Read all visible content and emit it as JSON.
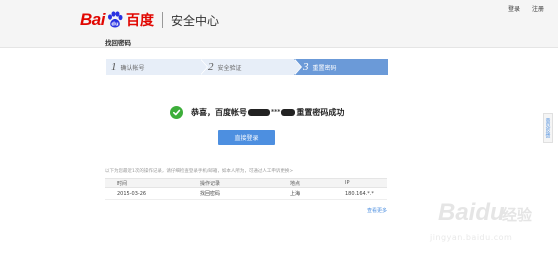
{
  "header": {
    "logo_bai": "Bai",
    "logo_du": "百度",
    "title": "安全中心",
    "links": [
      "登录",
      "注册"
    ]
  },
  "page": {
    "subtitle": "找回密码"
  },
  "steps": [
    {
      "num": "1",
      "label": "确认帐号"
    },
    {
      "num": "2",
      "label": "安全验证"
    },
    {
      "num": "3",
      "label": "重置密码"
    }
  ],
  "result": {
    "prefix": "恭喜，百度帐号",
    "middle": "***",
    "suffix": "重置密码成功"
  },
  "login_button": "直接登录",
  "note": "以下为您最近1次的操作记录，请仔细检查登录手机/邮箱，如本人所为，可通过人工申诉更换>",
  "table": {
    "headers": [
      "时间",
      "操作记录",
      "地点",
      "IP"
    ],
    "rows": [
      {
        "time": "2015-03-26",
        "action": "找回密码",
        "location": "上海",
        "ip": "180.164.*.*"
      }
    ],
    "view_more": "查看更多"
  },
  "feedback": "意见反馈",
  "watermark": {
    "brand": "Baidu",
    "sub": "经验",
    "url": "jingyan.baidu.com"
  },
  "colors": {
    "brand_red": "#e10601",
    "accent_blue": "#4d8fe0",
    "success_green": "#3dae3a",
    "step_active": "#6b9ad8"
  }
}
